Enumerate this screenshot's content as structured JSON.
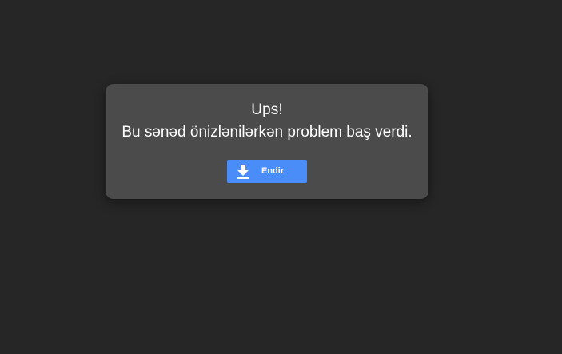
{
  "dialog": {
    "title": "Ups!",
    "message": "Bu sənəd önizlənilərkən problem baş verdi."
  },
  "download_button": {
    "label": "Endir",
    "icon": "download-icon"
  },
  "colors": {
    "background": "#262626",
    "dialog_background": "#4c4b4c",
    "button_accent": "#4a8df8",
    "text": "#ffffff"
  }
}
